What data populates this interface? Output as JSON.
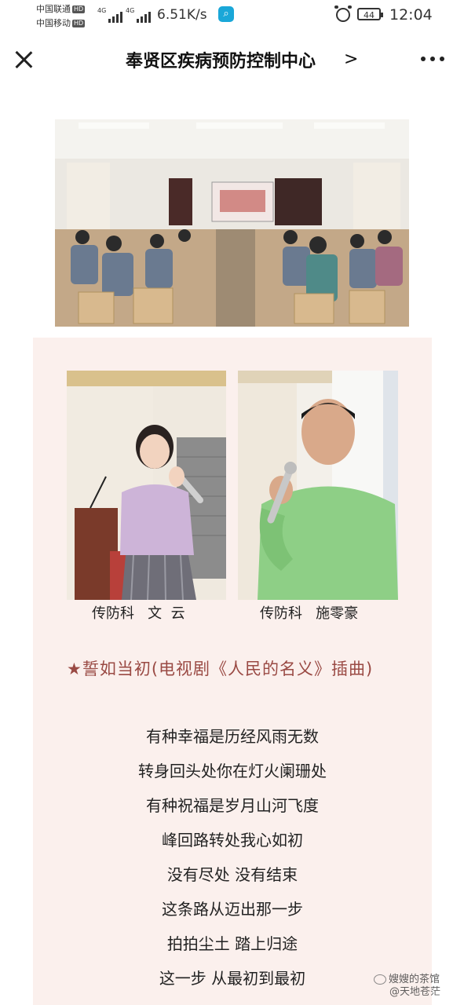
{
  "status_bar": {
    "carrier1": "中国联通",
    "carrier2": "中国移动",
    "hd_badge": "HD",
    "network_a": "4G",
    "network_b": "4G",
    "net_speed": "6.51K/s",
    "battery": "44",
    "time": "12:04"
  },
  "nav": {
    "title": "奉贤区疾病预防控制中心",
    "chevron": ">"
  },
  "captions": {
    "left": "传防科   文  云",
    "right": "传防科   施零豪"
  },
  "song": {
    "title": "★誓如当初(电视剧《人民的名义》插曲)",
    "lyrics": [
      "有种幸福是历经风雨无数",
      "转身回头处你在灯火阑珊处",
      "有种祝福是岁月山河飞度",
      "峰回路转处我心如初",
      "没有尽处 没有结束",
      "这条路从迈出那一步",
      "拍拍尘土 踏上归途",
      "这一步 从最初到最初"
    ]
  },
  "watermark": {
    "line1": "嫂嫂的茶馆",
    "line2": "@天地苍茫"
  },
  "icons": [
    "close-icon",
    "chevron-right-icon",
    "more-icon",
    "alarm-icon",
    "battery-icon",
    "search-app-icon",
    "weibo-icon"
  ]
}
